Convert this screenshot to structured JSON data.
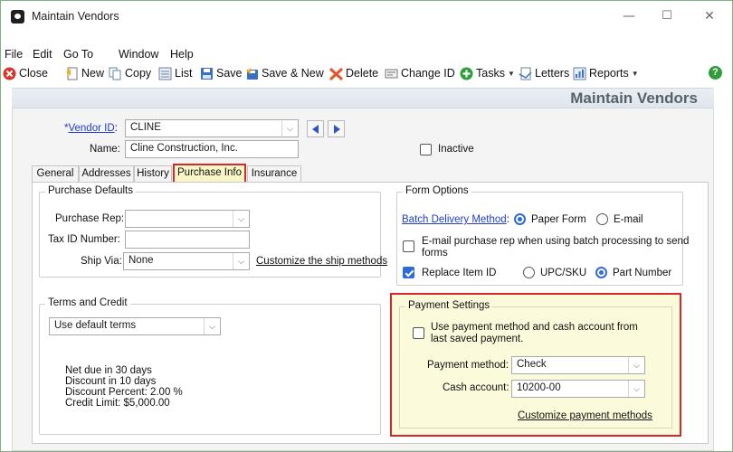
{
  "window": {
    "title": "Maintain Vendors",
    "minimize": "—",
    "maximize": "☐",
    "close": "✕"
  },
  "menu": [
    "File",
    "Edit",
    "Go To",
    "Window",
    "Help"
  ],
  "toolbar": {
    "close": "Close",
    "new": "New",
    "copy": "Copy",
    "list": "List",
    "save": "Save",
    "save_new": "Save & New",
    "delete": "Delete",
    "change_id": "Change ID",
    "tasks": "Tasks",
    "letters": "Letters",
    "reports": "Reports",
    "help": "?"
  },
  "header": {
    "title": "Maintain Vendors"
  },
  "vendor": {
    "id_req": "*",
    "id_label": "Vendor ID",
    "id_value": "CLINE",
    "name_label": "Name:",
    "name_value": "Cline Construction, Inc.",
    "inactive_label": "Inactive",
    "inactive": false
  },
  "tabs": [
    "General",
    "Addresses",
    "History",
    "Purchase Info",
    "Insurance"
  ],
  "active_tab": "Purchase Info",
  "purchase_defaults": {
    "title": "Purchase Defaults",
    "rep_label": "Purchase Rep:",
    "rep_value": "",
    "tax_label": "Tax ID Number:",
    "tax_value": "",
    "ship_label": "Ship Via:",
    "ship_value": "None",
    "customize_ship": "Customize the ship methods"
  },
  "form_options": {
    "title": "Form Options",
    "batch_label": "Batch Delivery Method",
    "batch_options": [
      "Paper Form",
      "E-mail"
    ],
    "batch_selected": "Paper Form",
    "email_rep_line1": "E-mail purchase rep when using batch processing to send",
    "email_rep_line2": "forms",
    "email_rep_checked": false,
    "replace_label": "Replace Item ID",
    "replace_checked": true,
    "replace_options": [
      "UPC/SKU",
      "Part Number"
    ],
    "replace_selected": "Part Number"
  },
  "terms": {
    "title": "Terms and Credit",
    "select_value": "Use default terms",
    "lines": [
      "Net due in 30 days",
      "Discount in 10 days",
      "Discount Percent: 2.00 %",
      "Credit Limit: $5,000.00"
    ]
  },
  "payment": {
    "title": "Payment Settings",
    "use_last_line1": "Use payment method and cash account from",
    "use_last_line2": "last saved payment.",
    "use_last_checked": false,
    "method_label": "Payment method:",
    "method_value": "Check",
    "cash_label": "Cash account:",
    "cash_value": "10200-00",
    "customize": "Customize payment methods"
  },
  "colors": {
    "highlight_border": "#d62828",
    "highlight_fill": "#fbfbdc",
    "link": "#1f3ec7",
    "accent": "#2f6bd8"
  }
}
